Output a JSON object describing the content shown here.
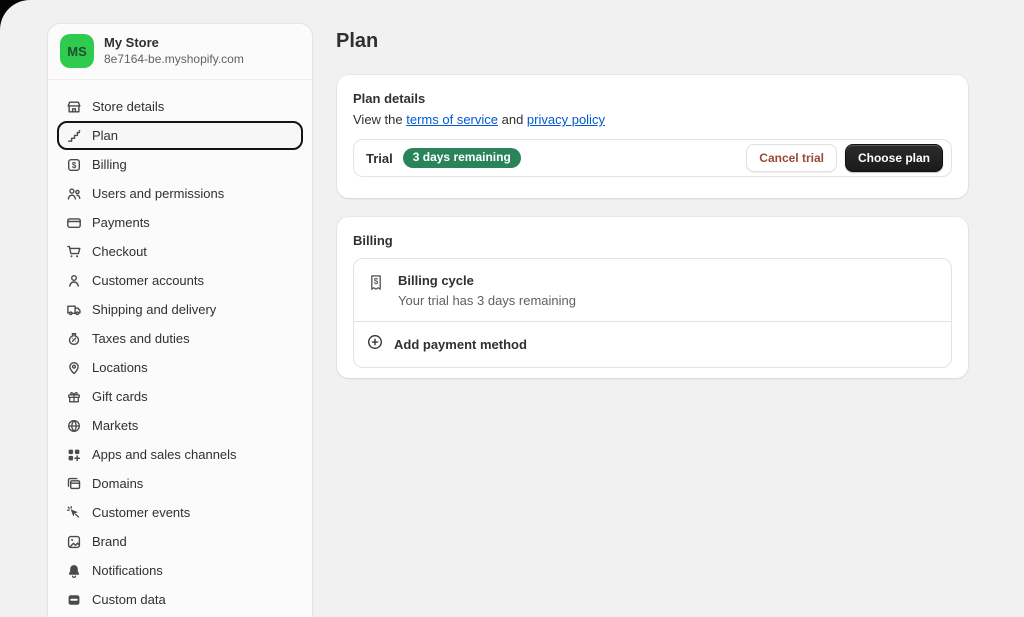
{
  "store": {
    "initials": "MS",
    "name": "My Store",
    "domain": "8e7164-be.myshopify.com"
  },
  "sidebar": {
    "items": [
      {
        "label": "Store details",
        "icon": "storefront-icon",
        "selected": false
      },
      {
        "label": "Plan",
        "icon": "plan-stairs-icon",
        "selected": true
      },
      {
        "label": "Billing",
        "icon": "dollar-square-icon",
        "selected": false
      },
      {
        "label": "Users and permissions",
        "icon": "users-icon",
        "selected": false
      },
      {
        "label": "Payments",
        "icon": "credit-card-icon",
        "selected": false
      },
      {
        "label": "Checkout",
        "icon": "cart-icon",
        "selected": false
      },
      {
        "label": "Customer accounts",
        "icon": "person-icon",
        "selected": false
      },
      {
        "label": "Shipping and delivery",
        "icon": "truck-icon",
        "selected": false
      },
      {
        "label": "Taxes and duties",
        "icon": "money-bag-icon",
        "selected": false
      },
      {
        "label": "Locations",
        "icon": "pin-icon",
        "selected": false
      },
      {
        "label": "Gift cards",
        "icon": "gift-icon",
        "selected": false
      },
      {
        "label": "Markets",
        "icon": "globe-icon",
        "selected": false
      },
      {
        "label": "Apps and sales channels",
        "icon": "apps-grid-icon",
        "selected": false
      },
      {
        "label": "Domains",
        "icon": "windows-icon",
        "selected": false
      },
      {
        "label": "Customer events",
        "icon": "cursor-icon",
        "selected": false
      },
      {
        "label": "Brand",
        "icon": "image-icon",
        "selected": false
      },
      {
        "label": "Notifications",
        "icon": "bell-icon",
        "selected": false
      },
      {
        "label": "Custom data",
        "icon": "database-icon",
        "selected": false
      }
    ]
  },
  "page": {
    "title": "Plan"
  },
  "plan_card": {
    "title": "Plan details",
    "view_prefix": "View the ",
    "terms_link": "terms of service",
    "and_text": " and ",
    "privacy_link": "privacy policy",
    "trial_label": "Trial",
    "trial_badge": "3 days remaining",
    "cancel_button": "Cancel trial",
    "choose_button": "Choose plan"
  },
  "billing_card": {
    "title": "Billing",
    "cycle_icon": "receipt-icon",
    "cycle_title": "Billing cycle",
    "cycle_subtitle": "Your trial has 3 days remaining",
    "add_icon": "plus-circle-icon",
    "add_payment_label": "Add payment method"
  },
  "colors": {
    "page_background": "#f1f1f2",
    "sidebar_background": "#fbfbfb",
    "card_background": "#ffffff",
    "border": "#e3e3e3",
    "text_primary": "#303030",
    "text_secondary": "#616161",
    "link_blue": "#005bd3",
    "badge_green": "#29845a",
    "avatar_green": "#2fcb4f",
    "critical_text": "#9c4836",
    "primary_button": "#1a1a1a"
  }
}
